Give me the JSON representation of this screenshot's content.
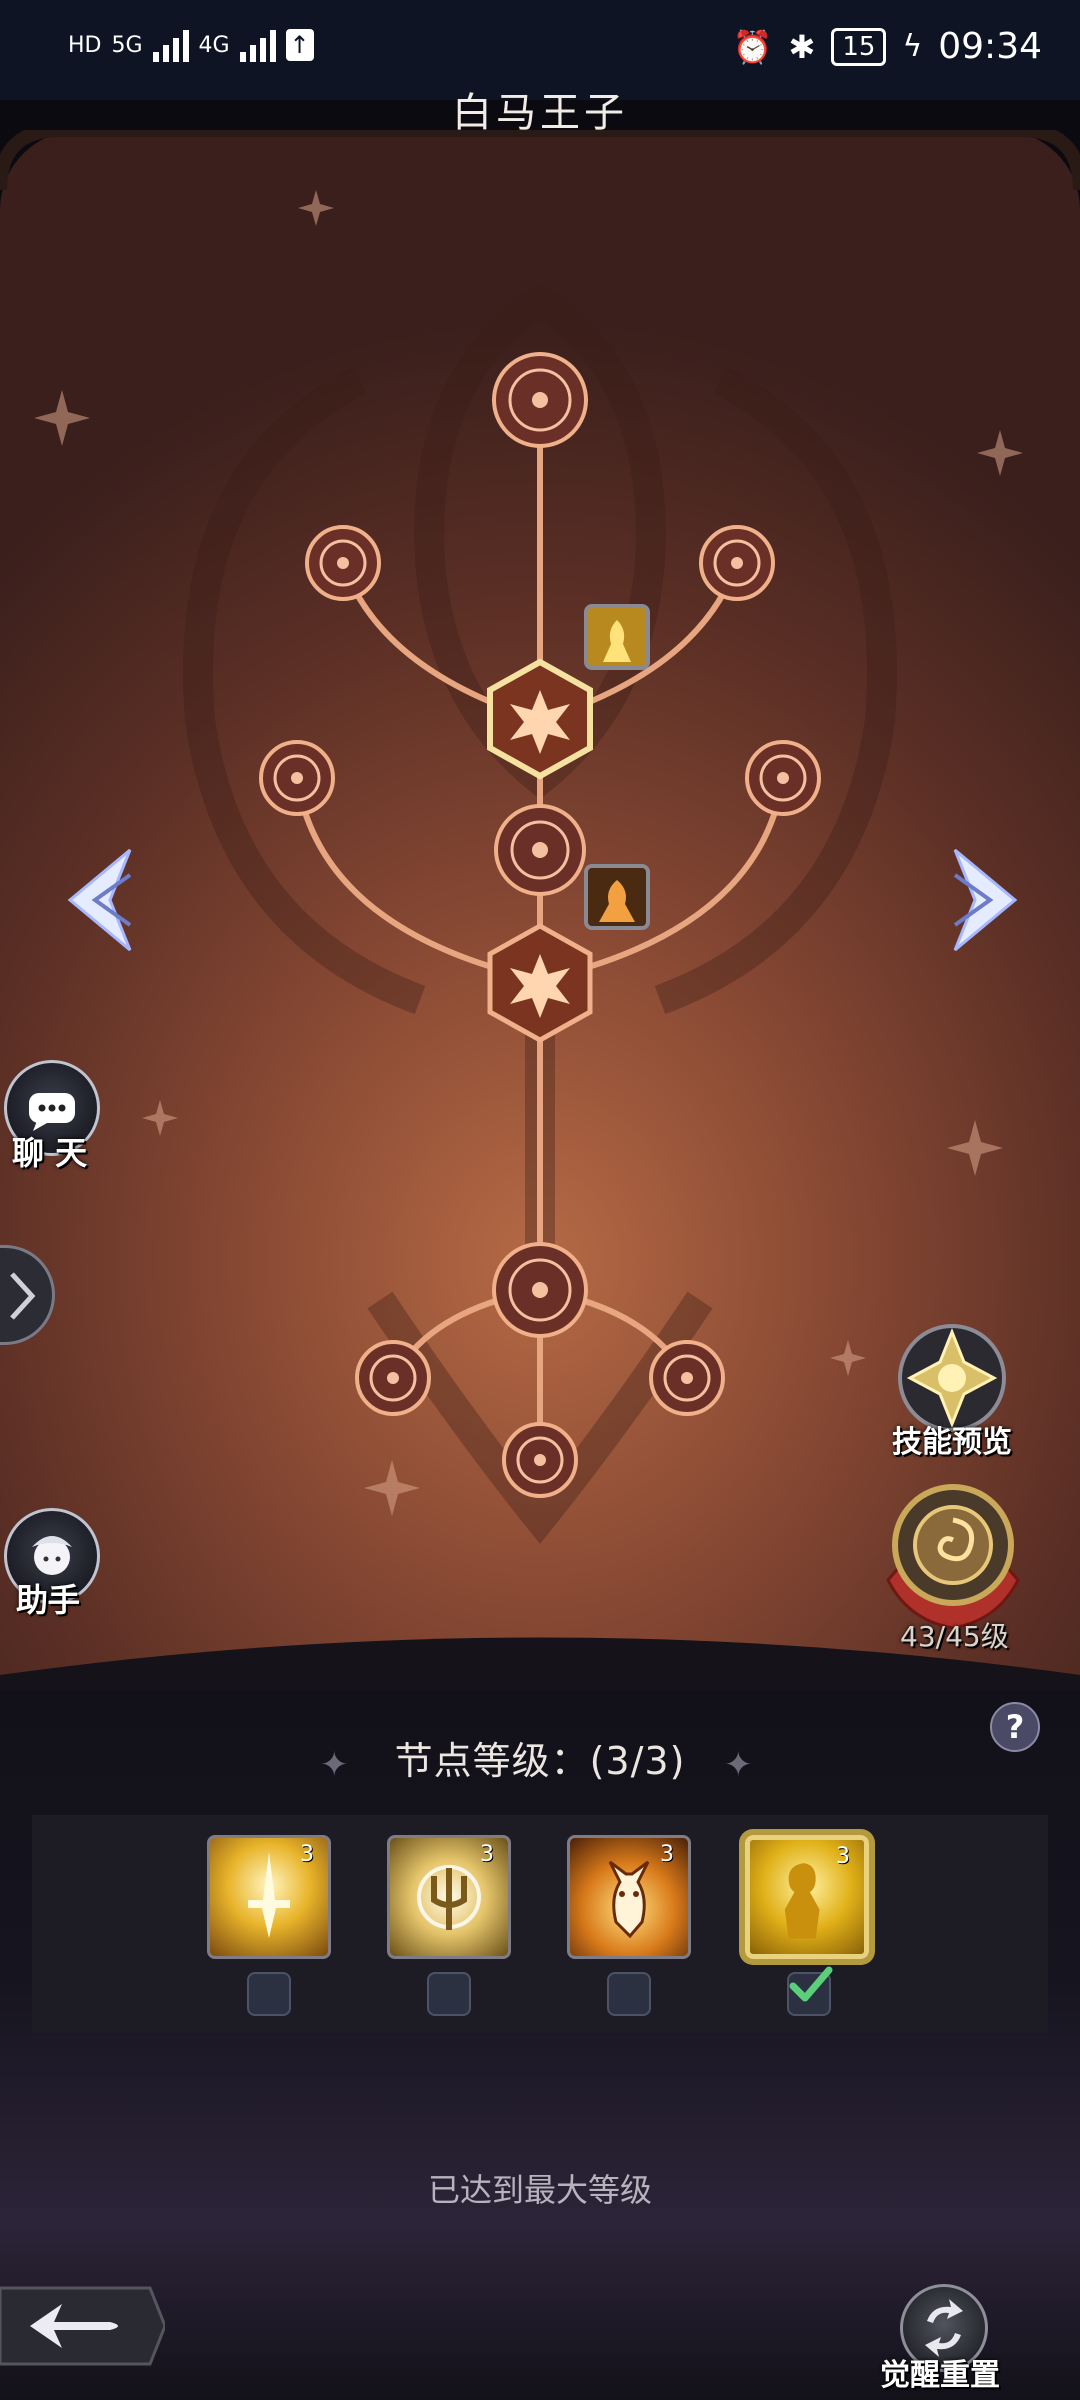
{
  "status_bar": {
    "network_left": "HD",
    "network_5g": "5G",
    "network_4g": "4G",
    "battery": "15",
    "time": "09:34"
  },
  "header": {
    "title": "白马王子"
  },
  "sidebar": {
    "chat_label": "聊 天",
    "assistant_label": "助手"
  },
  "right_panel": {
    "skill_preview_label": "技能预览",
    "level_badge": "43/45级"
  },
  "node_section": {
    "title": "节点等级：(3/3)",
    "options": [
      {
        "level": "3",
        "checked": false
      },
      {
        "level": "3",
        "checked": false
      },
      {
        "level": "3",
        "checked": false
      },
      {
        "level": "3",
        "checked": true
      }
    ],
    "max_message": "已达到最大等级"
  },
  "footer": {
    "reset_label": "觉醒重置"
  },
  "colors": {
    "accent_gold": "#e8d27e",
    "panel_copper": "#b56a45",
    "node_glow": "#f2b08a"
  }
}
